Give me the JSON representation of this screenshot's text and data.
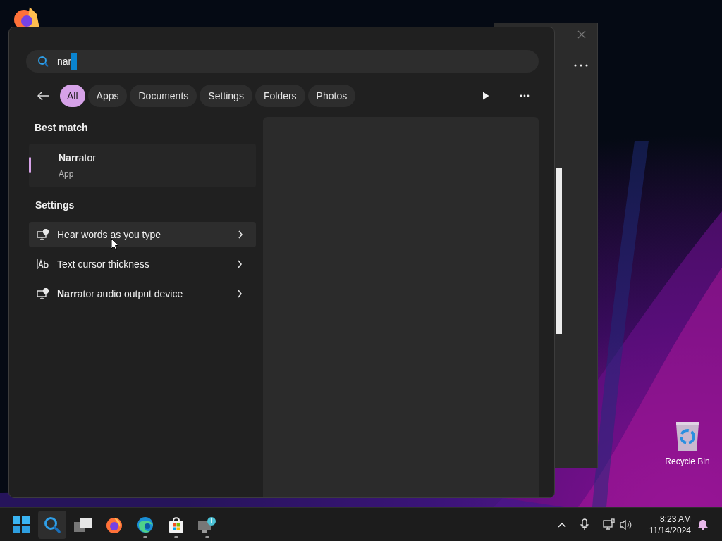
{
  "desktop": {
    "icons": [
      {
        "label": "Recycle Bin"
      }
    ]
  },
  "search_panel": {
    "search": {
      "value": "nar"
    },
    "filters": [
      {
        "label": "All",
        "selected": true
      },
      {
        "label": "Apps",
        "selected": false
      },
      {
        "label": "Documents",
        "selected": false
      },
      {
        "label": "Settings",
        "selected": false
      },
      {
        "label": "Folders",
        "selected": false
      },
      {
        "label": "Photos",
        "selected": false
      }
    ],
    "best_match": {
      "heading": "Best match",
      "title": "**Narr**ator",
      "subtitle": "App",
      "selected": true
    },
    "settings": {
      "heading": "Settings",
      "items": [
        {
          "label": "Hear words as you type",
          "kind": "display",
          "highlighted": true
        },
        {
          "label": "Text cursor thickness",
          "kind": "text-cursor",
          "highlighted": false
        },
        {
          "label": "**Narr**ator audio output device",
          "kind": "display",
          "highlighted": false
        }
      ]
    }
  },
  "taskbar": {
    "apps": [
      {
        "kind": "start",
        "selected": false,
        "running": false
      },
      {
        "kind": "search",
        "selected": true,
        "running": false
      },
      {
        "kind": "task-view",
        "selected": false,
        "running": false
      },
      {
        "kind": "firefox",
        "selected": false,
        "running": false
      },
      {
        "kind": "edge",
        "selected": false,
        "running": true
      },
      {
        "kind": "store",
        "selected": false,
        "running": true
      },
      {
        "kind": "pc-app",
        "selected": false,
        "running": true
      }
    ],
    "time": "8:23 AM",
    "date": "11/14/2024"
  }
}
